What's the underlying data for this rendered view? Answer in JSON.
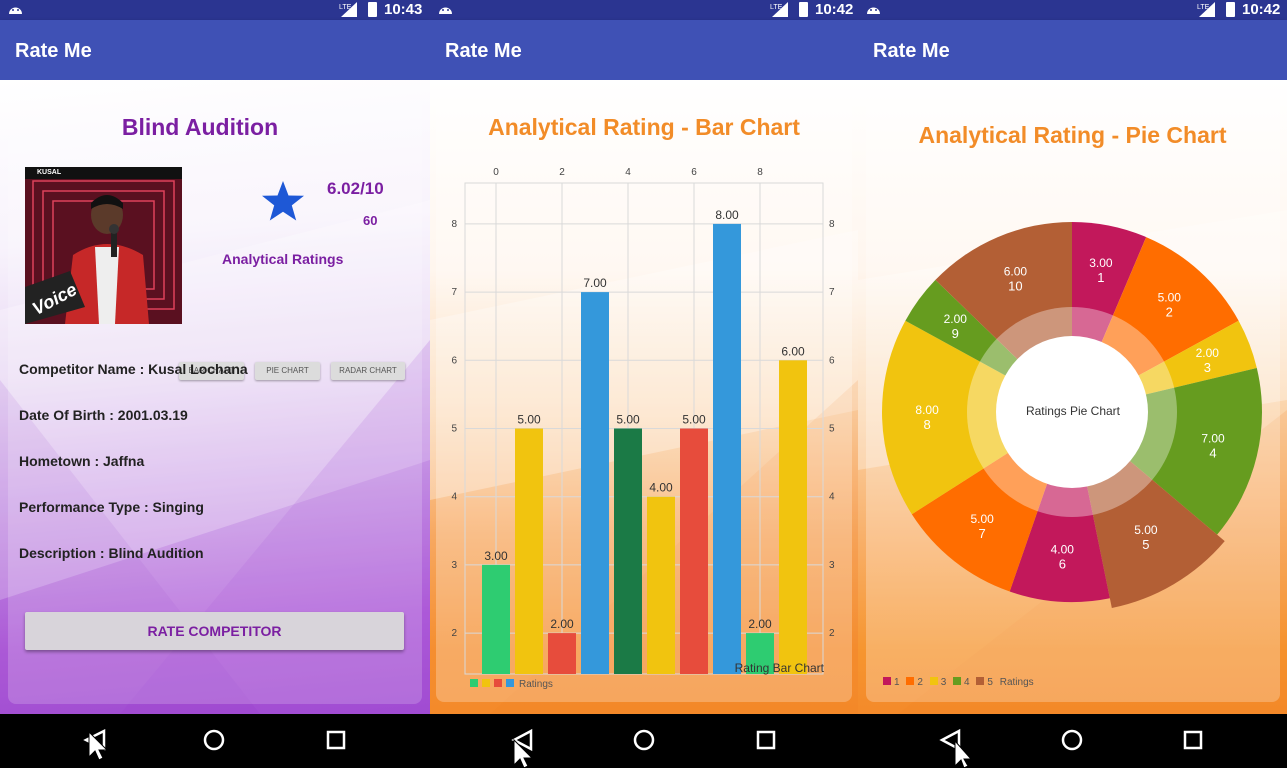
{
  "screens": [
    {
      "status": {
        "time": "10:43"
      },
      "appbar": {
        "title": "Rate Me"
      },
      "heading": "Blind Audition",
      "photo": {
        "caption": "KUSAL",
        "logo_text": "Voice"
      },
      "rating": {
        "score": "6.02/10",
        "count": "60"
      },
      "analytical_label": "Analytical Ratings",
      "buttons": {
        "bar": "BAR CHART",
        "pie": "PIE CHART",
        "radar": "RADAR CHART"
      },
      "details": {
        "name": "Competitor Name : Kusal Lochana",
        "dob": "Date Of Birth : 2001.03.19",
        "hometown": "Hometown : Jaffna",
        "performance": "Performance Type : Singing",
        "description": "Description : Blind Audition"
      },
      "rate_button": "RATE COMPETITOR"
    },
    {
      "status": {
        "time": "10:42"
      },
      "appbar": {
        "title": "Rate Me"
      },
      "heading": "Analytical Rating - Bar Chart",
      "description": "Rating Bar Chart",
      "legend_label": "Ratings"
    },
    {
      "status": {
        "time": "10:42"
      },
      "appbar": {
        "title": "Rate Me"
      },
      "heading": "Analytical Rating - Pie Chart",
      "center_text": "Ratings Pie Chart",
      "legend": [
        {
          "label": "1",
          "color": "#c2185b"
        },
        {
          "label": "2",
          "color": "#ff6d00"
        },
        {
          "label": "3",
          "color": "#f1c40f"
        },
        {
          "label": "4",
          "color": "#669c1f"
        },
        {
          "label": "5",
          "color": "#b35f35"
        }
      ],
      "legend_label": "Ratings"
    }
  ],
  "colors": {
    "appbar": "#3f51b5",
    "statusbar": "#2b3591",
    "purple": "#7b1fa2",
    "star": "#1e58d6",
    "orange_title": "#f28c28"
  },
  "chart_data": [
    {
      "type": "bar",
      "categories": [
        "1",
        "2",
        "3",
        "4",
        "5",
        "6",
        "7",
        "8",
        "9",
        "10"
      ],
      "series": [
        {
          "name": "Ratings",
          "values": [
            3,
            5,
            2,
            7,
            5,
            4,
            5,
            8,
            2,
            6
          ]
        }
      ],
      "value_labels": [
        "3.00",
        "5.00",
        "2.00",
        "7.00",
        "5.00",
        "4.00",
        "5.00",
        "8.00",
        "2.00",
        "6.00"
      ],
      "colors": [
        "#2ecc71",
        "#f1c40f",
        "#e74c3c",
        "#3498db",
        "#1b7a46",
        "#f1c40f",
        "#e74c3c",
        "#3498db",
        "#2ecc71",
        "#f1c40f"
      ],
      "x_axis_ticks": [
        "0",
        "2",
        "4",
        "6",
        "8"
      ],
      "ylim": [
        1.4,
        8.6
      ],
      "y_ticks": [
        "2",
        "3",
        "4",
        "5",
        "6",
        "7",
        "8"
      ],
      "grid": true,
      "legend_position": "bottom-left",
      "description": "Rating Bar Chart"
    },
    {
      "type": "pie",
      "categories": [
        "1",
        "2",
        "3",
        "4",
        "5",
        "6",
        "7",
        "8",
        "9",
        "10"
      ],
      "values": [
        3,
        5,
        2,
        7,
        5,
        4,
        5,
        8,
        2,
        6
      ],
      "value_labels": [
        "3.00",
        "5.00",
        "2.00",
        "7.00",
        "5.00",
        "4.00",
        "5.00",
        "8.00",
        "2.00",
        "6.00"
      ],
      "colors": [
        "#c2185b",
        "#ff6d00",
        "#f1c40f",
        "#669c1f",
        "#b35f35",
        "#c2185b",
        "#ff6d00",
        "#f1c40f",
        "#669c1f",
        "#b35f35"
      ],
      "selected_slice": "5",
      "center_text": "Ratings Pie Chart",
      "legend_position": "bottom-left"
    }
  ]
}
